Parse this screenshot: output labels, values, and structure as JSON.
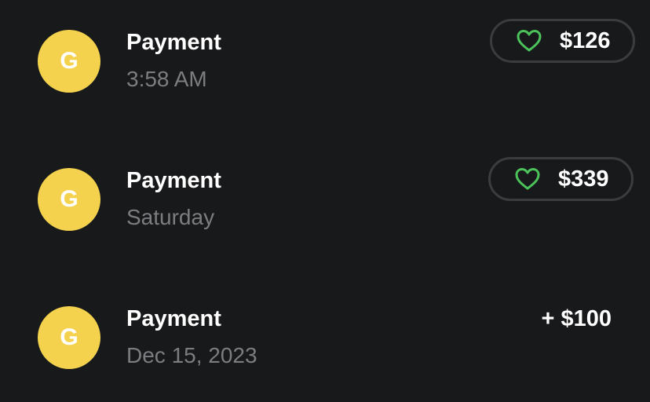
{
  "transactions": [
    {
      "avatar_initial": "G",
      "title": "Payment",
      "time": "3:58 AM",
      "amount": "$126",
      "style": "pill",
      "icon": "heart-outline-icon"
    },
    {
      "avatar_initial": "G",
      "title": "Payment",
      "time": "Saturday",
      "amount": "$339",
      "style": "pill",
      "icon": "heart-outline-icon"
    },
    {
      "avatar_initial": "G",
      "title": "Payment",
      "time": "Dec 15, 2023",
      "amount": "+ $100",
      "style": "plain"
    }
  ],
  "colors": {
    "background": "#18191b",
    "avatar": "#f4d24d",
    "heart": "#4cc35a",
    "pill_border": "#3b3c3f",
    "secondary_text": "#7c7d80"
  }
}
